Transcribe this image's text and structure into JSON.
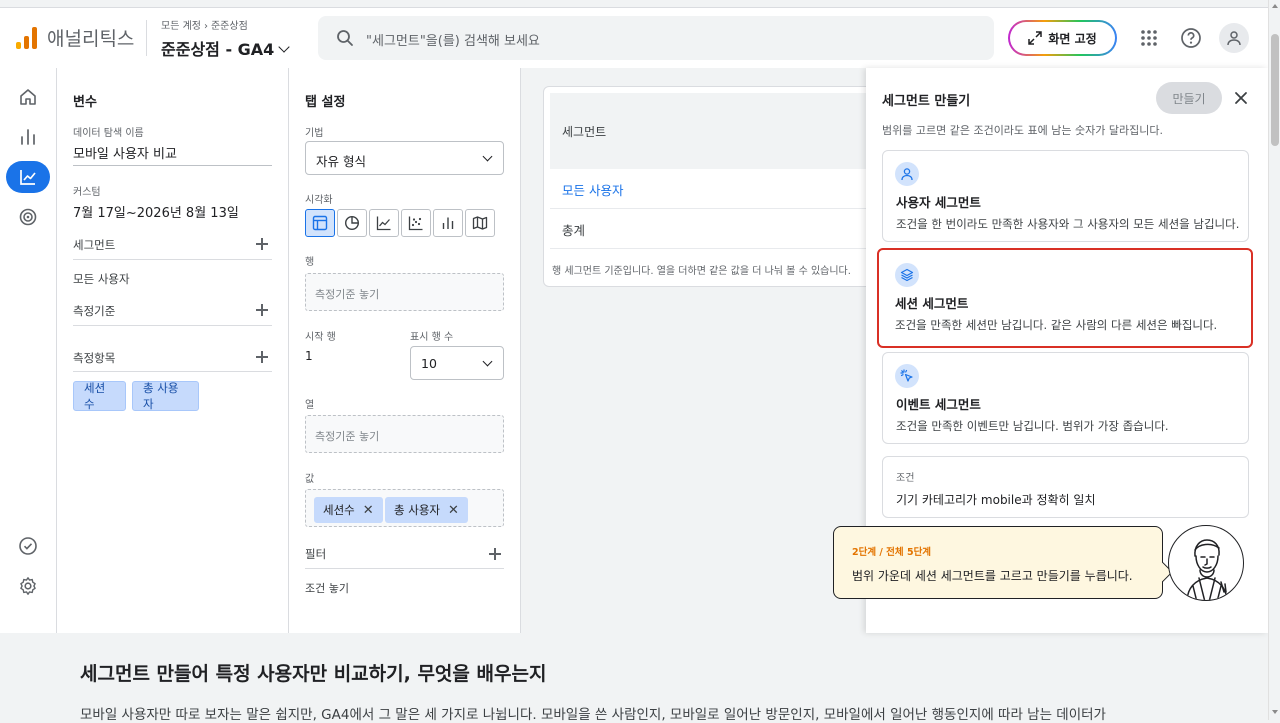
{
  "app": {
    "brand": "애널리틱스",
    "breadcrumb": [
      "모든 계정",
      "준준상점"
    ],
    "property": "준준상점 - GA4",
    "search_placeholder": "\"세그먼트\"을(를) 검색해 보세요",
    "pin_label": "화면 고정"
  },
  "variables": {
    "title": "변수",
    "exploration_name_label": "데이터 탐색 이름",
    "exploration_name": "모바일 사용자 비교",
    "custom_label": "커스텀",
    "date_range": "7월 17일~2026년 8월 13일",
    "segments_label": "세그먼트",
    "segment_items": [
      "모든 사용자"
    ],
    "dimensions_label": "측정기준",
    "metrics_label": "측정항목",
    "metric_chips": [
      "세션수",
      "총 사용자"
    ]
  },
  "tab_settings": {
    "title": "탭 설정",
    "technique_label": "기법",
    "technique_value": "자유 형식",
    "visualization_label": "시각화",
    "rows_label": "행",
    "rows_drop": "측정기준 놓기",
    "start_row_label": "시작 행",
    "start_row_value": "1",
    "show_rows_label": "표시 행 수",
    "show_rows_value": "10",
    "columns_label": "열",
    "columns_drop": "측정기준 놓기",
    "values_label": "값",
    "value_chips": [
      "세션수",
      "총 사용자"
    ],
    "filters_label": "필터",
    "filters_drop": "조건 놓기"
  },
  "table": {
    "header": "세그먼트",
    "rows": [
      "모든 사용자",
      "총계"
    ],
    "note": "행 세그먼트 기준입니다. 열을 더하면 같은 값을 더 나눠 볼 수 있습니다."
  },
  "segment_builder": {
    "title": "세그먼트 만들기",
    "create_label": "만들기",
    "description": "범위를 고르면 같은 조건이라도 표에 남는 숫자가 달라집니다.",
    "cards": [
      {
        "title": "사용자 세그먼트",
        "desc": "조건을 한 번이라도 만족한 사용자와 그 사용자의 모든 세션을 남깁니다.",
        "icon": "person-icon"
      },
      {
        "title": "세션 세그먼트",
        "desc": "조건을 만족한 세션만 남깁니다. 같은 사람의 다른 세션은 빠집니다.",
        "icon": "layers-icon"
      },
      {
        "title": "이벤트 세그먼트",
        "desc": "조건을 만족한 이벤트만 남깁니다. 범위가 가장 좁습니다.",
        "icon": "cursor-click-icon"
      }
    ],
    "condition_label": "조건",
    "condition_text": "기기 카테고리가 mobile과 정확히 일치"
  },
  "guide": {
    "step": "2단계 / 전체 5단계",
    "message": "범위 가운데 세션 세그먼트를 고르고 만들기를 누릅니다."
  },
  "article": {
    "title": "세그먼트 만들어 특정 사용자만 비교하기, 무엇을 배우는지",
    "body": "모바일 사용자만 따로 보자는 말은 쉽지만, GA4에서 그 말은 세 가지로 나뉩니다. 모바일을 쓴 사람인지, 모바일로 일어난 방문인지, 모바일에서 일어난 행동인지에 따라 남는 데이터가"
  },
  "colors": {
    "accent": "#1a73e8",
    "highlight_border": "#d93025",
    "chip_bg": "#c6dafc",
    "tooltip_bg": "#fef7e0",
    "step_color": "#e37400"
  }
}
